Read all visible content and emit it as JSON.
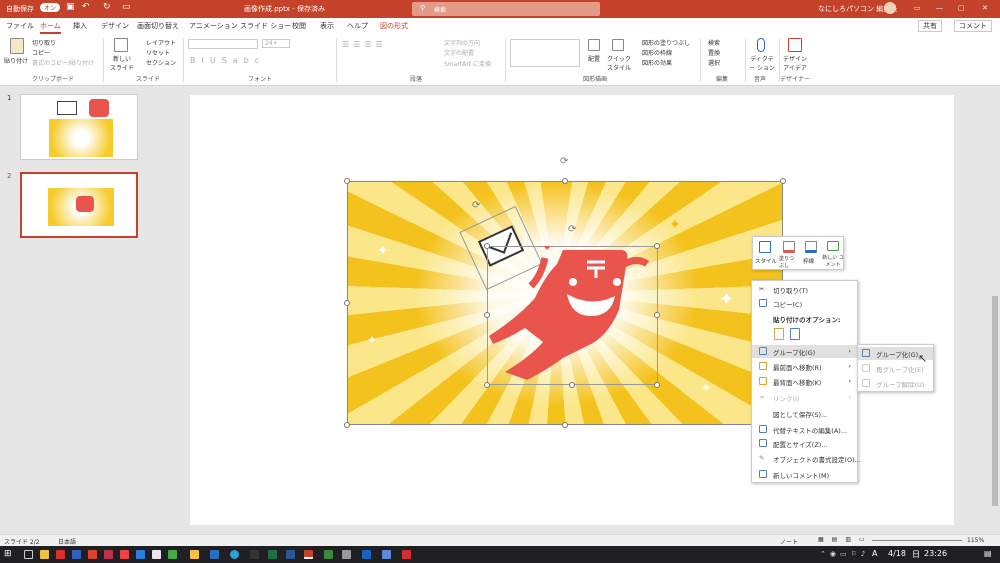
{
  "titlebar": {
    "autosave_label": "自動保存",
    "autosave_toggle": "オン",
    "filename": "画像作成.pptx - 保存済み",
    "search_placeholder": "検索",
    "user": "なにしろパソコン 編集長",
    "colors": {
      "accent": "#c5422a"
    }
  },
  "tabs": [
    {
      "label": "ファイル"
    },
    {
      "label": "ホーム"
    },
    {
      "label": "挿入"
    },
    {
      "label": "デザイン"
    },
    {
      "label": "画面切り替え"
    },
    {
      "label": "アニメーション"
    },
    {
      "label": "スライド ショー"
    },
    {
      "label": "校閲"
    },
    {
      "label": "表示"
    },
    {
      "label": "ヘルプ"
    },
    {
      "label": "図の形式"
    }
  ],
  "share": {
    "share_label": "共有",
    "comment_label": "コメント"
  },
  "ribbon": {
    "paste": "貼り付け",
    "cut": "切り取り",
    "copy": "コピー",
    "format_painter": "書式のコピー/貼り付け",
    "clipboard_group": "クリップボード",
    "new_slide": "新しい スライド",
    "layout": "レイアウト",
    "reset": "リセット",
    "section": "セクション",
    "slides_group": "スライド",
    "font_size": "24+",
    "font_group": "フォント",
    "text_direction": "文字列の方向",
    "align_text": "文字の配置",
    "smartart": "SmartArt に変換",
    "paragraph_group": "段落",
    "arrange": "配置",
    "quick_styles": "クイック スタイル",
    "shape_fill": "図形の塗りつぶし",
    "shape_outline": "図形の枠線",
    "shape_effects": "図形の効果",
    "drawing_group": "図形描画",
    "find": "検索",
    "replace": "置換",
    "select": "選択",
    "editing_group": "編集",
    "dictate": "ディクテー ション",
    "voice_group": "音声",
    "designer": "デザイン アイデア",
    "designer_group": "デザイナー"
  },
  "thumbs": [
    {
      "number": "1"
    },
    {
      "number": "2"
    }
  ],
  "mini_toolbar": {
    "style": "スタイル",
    "fill": "塗りつ ぶし",
    "outline": "枠線",
    "new_comment": "新しい コメント"
  },
  "context_menu": {
    "cut": "切り取り(T)",
    "copy": "コピー(C)",
    "paste_options": "貼り付けのオプション:",
    "group": "グループ化(G)",
    "bring_front": "最前面へ移動(R)",
    "send_back": "最背面へ移動(K)",
    "link": "リンク(I)",
    "save_as_picture": "図として保存(S)...",
    "alt_text": "代替テキストの編集(A)...",
    "size_position": "配置とサイズ(Z)...",
    "format_object": "オブジェクトの書式設定(O)...",
    "new_comment": "新しいコメント(M)"
  },
  "submenu": {
    "group": "グループ化(G)",
    "regroup": "再グループ化(E)",
    "ungroup": "グループ解除(U)"
  },
  "status": {
    "slide_info": "スライド 2/2",
    "language": "日本語",
    "notes": "ノート",
    "zoom": "115%"
  },
  "taskbar": {
    "ime": "A",
    "date": "4/18",
    "day": "日",
    "time": "23:26"
  }
}
